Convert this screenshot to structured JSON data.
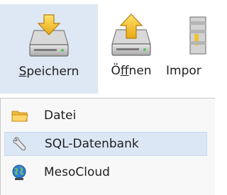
{
  "ribbon": {
    "buttons": [
      {
        "label": "Speichern",
        "mnemonic": "S",
        "rest": "peichern",
        "icon": "save-drive-icon",
        "active": true
      },
      {
        "label": "Öffnen",
        "prefix": "Ö",
        "mnemonic": "f",
        "rest": "fnen",
        "icon": "open-drive-icon"
      },
      {
        "label": "Impor",
        "icon": "import-icon"
      }
    ]
  },
  "menu": {
    "items": [
      {
        "label": "Datei",
        "icon": "folder-icon"
      },
      {
        "label": "SQL-Datenbank",
        "icon": "wrench-icon",
        "highlighted": true
      },
      {
        "label": "MesoCloud",
        "icon": "globe-icon"
      }
    ]
  },
  "colors": {
    "active_bg": "#dde8f4",
    "hover_bg": "#dbe7f5",
    "menu_bg": "#f8f8f8",
    "arrow_yellow": "#f2c230"
  }
}
